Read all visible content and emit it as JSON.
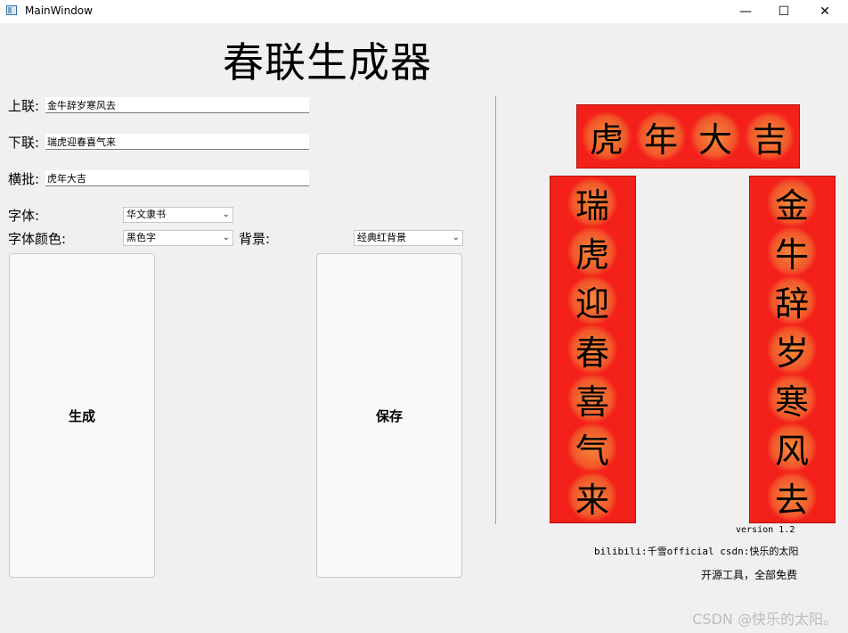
{
  "window": {
    "title": "MainWindow",
    "minimize": "—",
    "maximize": "☐",
    "close": "✕"
  },
  "app_title": "春联生成器",
  "form": {
    "upper_label": "上联:",
    "upper_value": "金牛辞岁寒风去",
    "lower_label": "下联:",
    "lower_value": "瑞虎迎春喜气来",
    "horizontal_label": "横批:",
    "horizontal_value": "虎年大吉",
    "font_label": "字体:",
    "font_value": "华文隶书",
    "color_label": "字体颜色:",
    "color_value": "黑色字",
    "background_label": "背景:",
    "background_value": "经典红背景"
  },
  "buttons": {
    "generate": "生成",
    "save": "保存"
  },
  "preview": {
    "horizontal_chars": [
      "虎",
      "年",
      "大",
      "吉"
    ],
    "left_chars": [
      "瑞",
      "虎",
      "迎",
      "春",
      "喜",
      "气",
      "来"
    ],
    "right_chars": [
      "金",
      "牛",
      "辞",
      "岁",
      "寒",
      "风",
      "去"
    ],
    "paper_color": "#f4201a",
    "ink_color": "#000000"
  },
  "version": "version 1.2",
  "credit": "bilibili:千雪official csdn:快乐的太阳",
  "free_note": "开源工具，全部免费",
  "watermark": "CSDN @快乐的太阳。"
}
